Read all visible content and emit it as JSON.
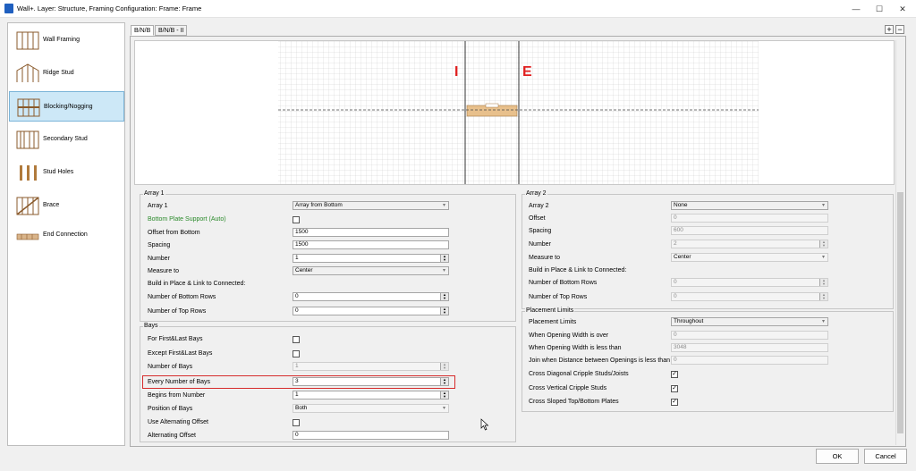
{
  "window": {
    "title": "Wall+. Layer: Structure, Framing Configuration: Frame: Frame",
    "minimize": "—",
    "maximize": "☐",
    "close": "✕"
  },
  "sidebar": {
    "items": [
      {
        "label": "Wall Framing",
        "icon": "wall-framing-icon"
      },
      {
        "label": "Ridge Stud",
        "icon": "ridge-stud-icon"
      },
      {
        "label": "Blocking/Nogging",
        "icon": "blocking-icon"
      },
      {
        "label": "Secondary Stud",
        "icon": "secondary-stud-icon"
      },
      {
        "label": "Stud Holes",
        "icon": "stud-holes-icon"
      },
      {
        "label": "Brace",
        "icon": "brace-icon"
      },
      {
        "label": "End Connection",
        "icon": "end-connection-icon"
      }
    ]
  },
  "tabs": [
    "B/N/B",
    "B/N/B - II"
  ],
  "toolbar": {
    "plus": "+",
    "minus": "−"
  },
  "preview": {
    "marker_left": "I",
    "marker_right": "E"
  },
  "array1": {
    "title": "Array 1",
    "array_label": "Array 1",
    "array_value": "Array from Bottom",
    "bottom_plate_label": "Bottom Plate Support (Auto)",
    "offset_label": "Offset from Bottom",
    "offset_value": "1500",
    "spacing_label": "Spacing",
    "spacing_value": "1500",
    "number_label": "Number",
    "number_value": "1",
    "measure_label": "Measure to",
    "measure_value": "Center",
    "build_label": "Build in Place & Link to Connected:",
    "bottom_rows_label": "Number of Bottom Rows",
    "bottom_rows_value": "0",
    "top_rows_label": "Number of Top Rows",
    "top_rows_value": "0"
  },
  "array2": {
    "title": "Array 2",
    "array_label": "Array 2",
    "array_value": "None",
    "offset_label": "Offset",
    "offset_value": "0",
    "spacing_label": "Spacing",
    "spacing_value": "600",
    "number_label": "Number",
    "number_value": "2",
    "measure_label": "Measure to",
    "measure_value": "Center",
    "build_label": "Build in Place & Link to Connected:",
    "bottom_rows_label": "Number of Bottom Rows",
    "bottom_rows_value": "0",
    "top_rows_label": "Number of Top Rows",
    "top_rows_value": "0"
  },
  "bays": {
    "title": "Bays",
    "first_last_label": "For First&Last Bays",
    "except_label": "Except First&Last Bays",
    "num_bays_label": "Number of Bays",
    "num_bays_value": "1",
    "every_label": "Every Number of Bays",
    "every_value": "3",
    "begins_label": "Begins from Number",
    "begins_value": "1",
    "position_label": "Position of Bays",
    "position_value": "Both",
    "alt_offset_use_label": "Use Alternating Offset",
    "alt_offset_label": "Alternating Offset",
    "alt_offset_value": "0"
  },
  "placement": {
    "title": "Placement Limits",
    "limits_label": "Placement Limits",
    "limits_value": "Throughout",
    "over_label": "When Opening Width is over",
    "over_value": "0",
    "less_label": "When Opening Width is less than",
    "less_value": "3048",
    "join_label": "Join when Distance between Openings is less than",
    "join_value": "0",
    "diag_label": "Cross Diagonal Cripple Studs/Joists",
    "vert_label": "Cross Vertical Cripple Studs",
    "sloped_label": "Cross Sloped Top/Bottom Plates"
  },
  "buttons": {
    "ok": "OK",
    "cancel": "Cancel"
  },
  "colors": {
    "accent": "#cde8f7",
    "highlight": "#d62b2b",
    "marker": "#e02020",
    "block": "#e8c08c"
  }
}
